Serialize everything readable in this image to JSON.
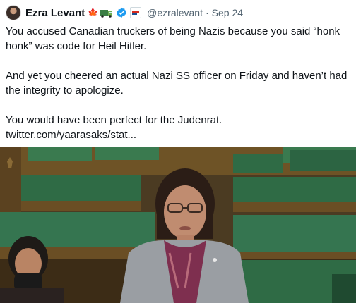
{
  "author": {
    "name": "Ezra Levant",
    "handle": "@ezralevant",
    "separator": "·",
    "date": "Sep 24",
    "icons": [
      "maple-leaf-icon",
      "truck-icon",
      "verified-badge-icon",
      "affiliation-badge-icon"
    ]
  },
  "tweet": {
    "paragraph1": "You accused Canadian truckers of being Nazis because you said “honk honk” was code for Heil Hitler.",
    "paragraph2": "And yet you cheered an actual Nazi SS officer on Friday and haven’t had the integrity to apologize.",
    "paragraph3": "You would have been perfect for the Judenrat.",
    "link": "twitter.com/yaarasaks/stat..."
  },
  "media": {
    "type": "video-still",
    "scene": "parliament-chamber",
    "colors": {
      "benches": "#2f6b45",
      "wood": "#7a5a2a",
      "jacket": "#9a9ea3",
      "scarf": "#7e2f4f"
    }
  },
  "colors": {
    "text": "#0f1419",
    "secondary": "#536471",
    "verified": "#1d9bf0",
    "flag": "#d52b1e"
  }
}
